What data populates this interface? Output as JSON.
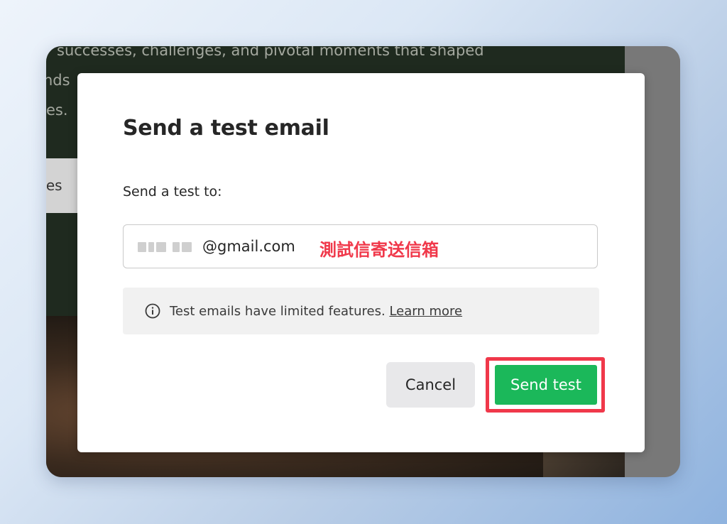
{
  "background": {
    "text_lines": [
      "successes, challenges, and pivotal moments that shaped",
      "nds",
      "es."
    ],
    "button_fragment": "ves"
  },
  "modal": {
    "title": "Send a test email",
    "field_label": "Send a test to:",
    "email_domain": "@gmail.com",
    "email_annotation": "測試信寄送信箱",
    "info_text": "Test emails have limited features.",
    "info_link": "Learn more",
    "cancel_label": "Cancel",
    "send_label": "Send test"
  },
  "icons": {
    "info": "info-circle-icon"
  },
  "colors": {
    "send_button": "#1bb85a",
    "highlight": "#f0384a",
    "annotation": "#f0384a"
  }
}
